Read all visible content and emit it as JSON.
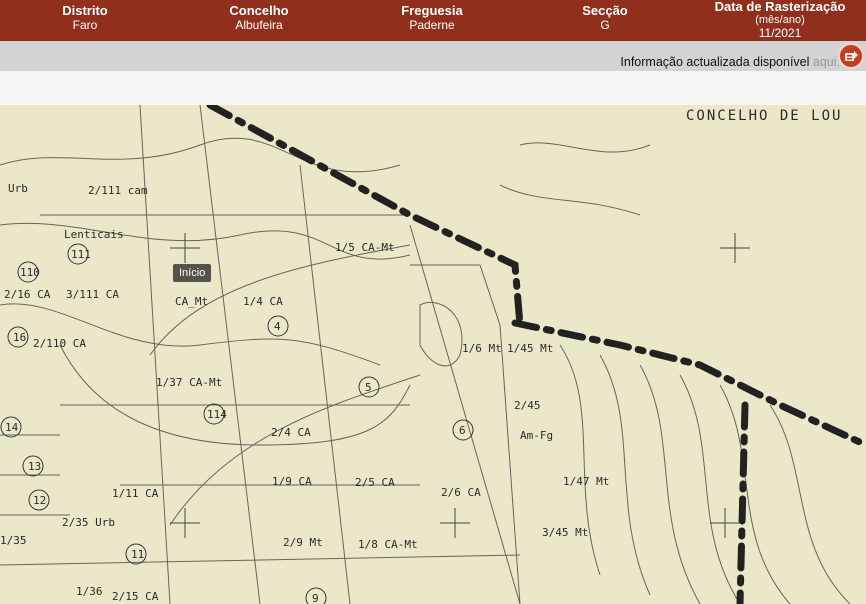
{
  "header": {
    "distrito": {
      "label": "Distrito",
      "value": "Faro"
    },
    "concelho": {
      "label": "Concelho",
      "value": "Albufeira"
    },
    "freguesia": {
      "label": "Freguesia",
      "value": "Paderne"
    },
    "seccao": {
      "label": "Secção",
      "value": "G"
    },
    "data_rasterizacao": {
      "label": "Data de Rasterização",
      "sub": "(mês/ano)",
      "value": "11/2021"
    }
  },
  "info": {
    "text": "Informação actualizada disponível ",
    "link": "aqui."
  },
  "map": {
    "tooltip": "Início",
    "concelho_label": "CONCELHO DE LOU",
    "place_label": "Lenticais",
    "parcels": [
      "111",
      "110",
      "16",
      "14",
      "13",
      "12",
      "11",
      "4",
      "5",
      "6",
      "114",
      "9"
    ],
    "annotations": [
      "2/111 cam",
      "1/5 CA-Mt",
      "1/4 CA",
      "CA_Mt",
      "3/111 CA",
      "2/16 CA",
      "2/110 CA",
      "1/37 CA-Mt",
      "2/4 CA",
      "1/9 CA",
      "2/5 CA",
      "2/6 CA",
      "1/11 CA",
      "2/9 Mt",
      "1/8 CA-Mt",
      "1/6 Mt",
      "1/45 Mt",
      "2/45",
      "Am-Fg",
      "1/47 Mt",
      "3/45 Mt",
      "2/35 Urb",
      "1/35",
      "1/36",
      "2/15 CA",
      "Urb"
    ]
  },
  "colors": {
    "header": "#8f2f1c",
    "bar": "#d3d3d3",
    "map": "#ebe8c9"
  }
}
